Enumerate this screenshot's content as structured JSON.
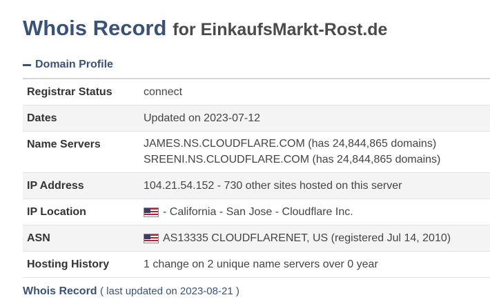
{
  "header": {
    "title_main": "Whois Record",
    "title_for": "for EinkaufsMarkt-Rost.de"
  },
  "domain_profile": {
    "section_label": "Domain Profile",
    "rows": [
      {
        "label": "Registrar Status",
        "value": "connect"
      },
      {
        "label": "Dates",
        "value": "Updated on 2023-07-12"
      },
      {
        "label": "Name Servers",
        "line1": "JAMES.NS.CLOUDFLARE.COM (has 24,844,865 domains)",
        "line2": "SREENI.NS.CLOUDFLARE.COM (has 24,844,865 domains)"
      },
      {
        "label": "IP Address",
        "value": "104.21.54.152 - 730 other sites hosted on this server"
      },
      {
        "label": "IP Location",
        "value": " - California - San Jose - Cloudflare Inc.",
        "flag": "us-flag-icon"
      },
      {
        "label": "ASN",
        "value": "AS13335 CLOUDFLARENET, US (registered Jul 14, 2010)",
        "flag": "us-flag-icon"
      },
      {
        "label": "Hosting History",
        "value": "1 change on 2 unique name servers over 0 year"
      }
    ]
  },
  "footer": {
    "link_label": "Whois Record",
    "updated_text": "( last updated on 2023-08-21 )"
  }
}
